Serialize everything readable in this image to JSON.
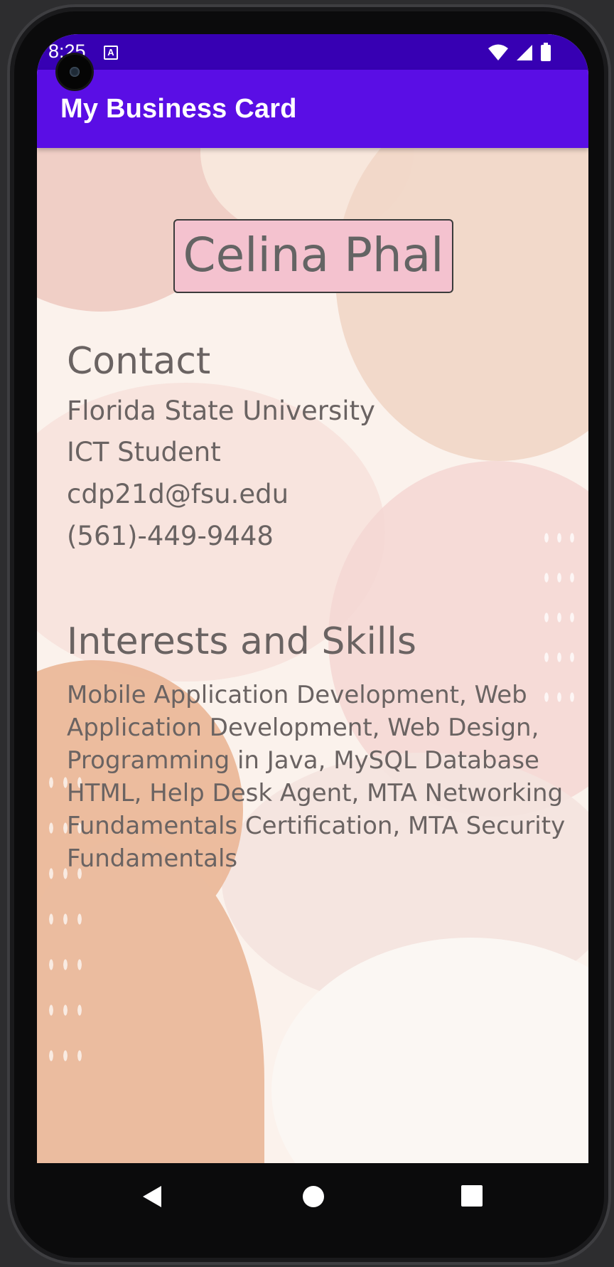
{
  "status_bar": {
    "time": "8:25",
    "notification_icon": "a-badge-icon",
    "wifi_icon": "wifi-icon",
    "signal_icon": "cellular-signal-icon",
    "battery_icon": "battery-icon",
    "color": "#3700b3"
  },
  "app_bar": {
    "title": "My Business Card",
    "color": "#5a0ee5"
  },
  "card": {
    "name": "Celina Phal",
    "name_background": "#f4c2cf",
    "contact_heading": "Contact",
    "contact_lines": [
      "Florida State University",
      "ICT Student",
      "cdp21d@fsu.edu",
      "(561)-449-9448"
    ],
    "skills_heading": "Interests and Skills",
    "skills_text": "Mobile Application Development, Web Application Development, Web Design, Programming in Java, MySQL Database HTML, Help Desk Agent, MTA Networking Fundamentals Certification, MTA Security Fundamentals"
  },
  "navigation": {
    "back": "back-triangle-icon",
    "home": "home-circle-icon",
    "recents": "recents-square-icon"
  }
}
